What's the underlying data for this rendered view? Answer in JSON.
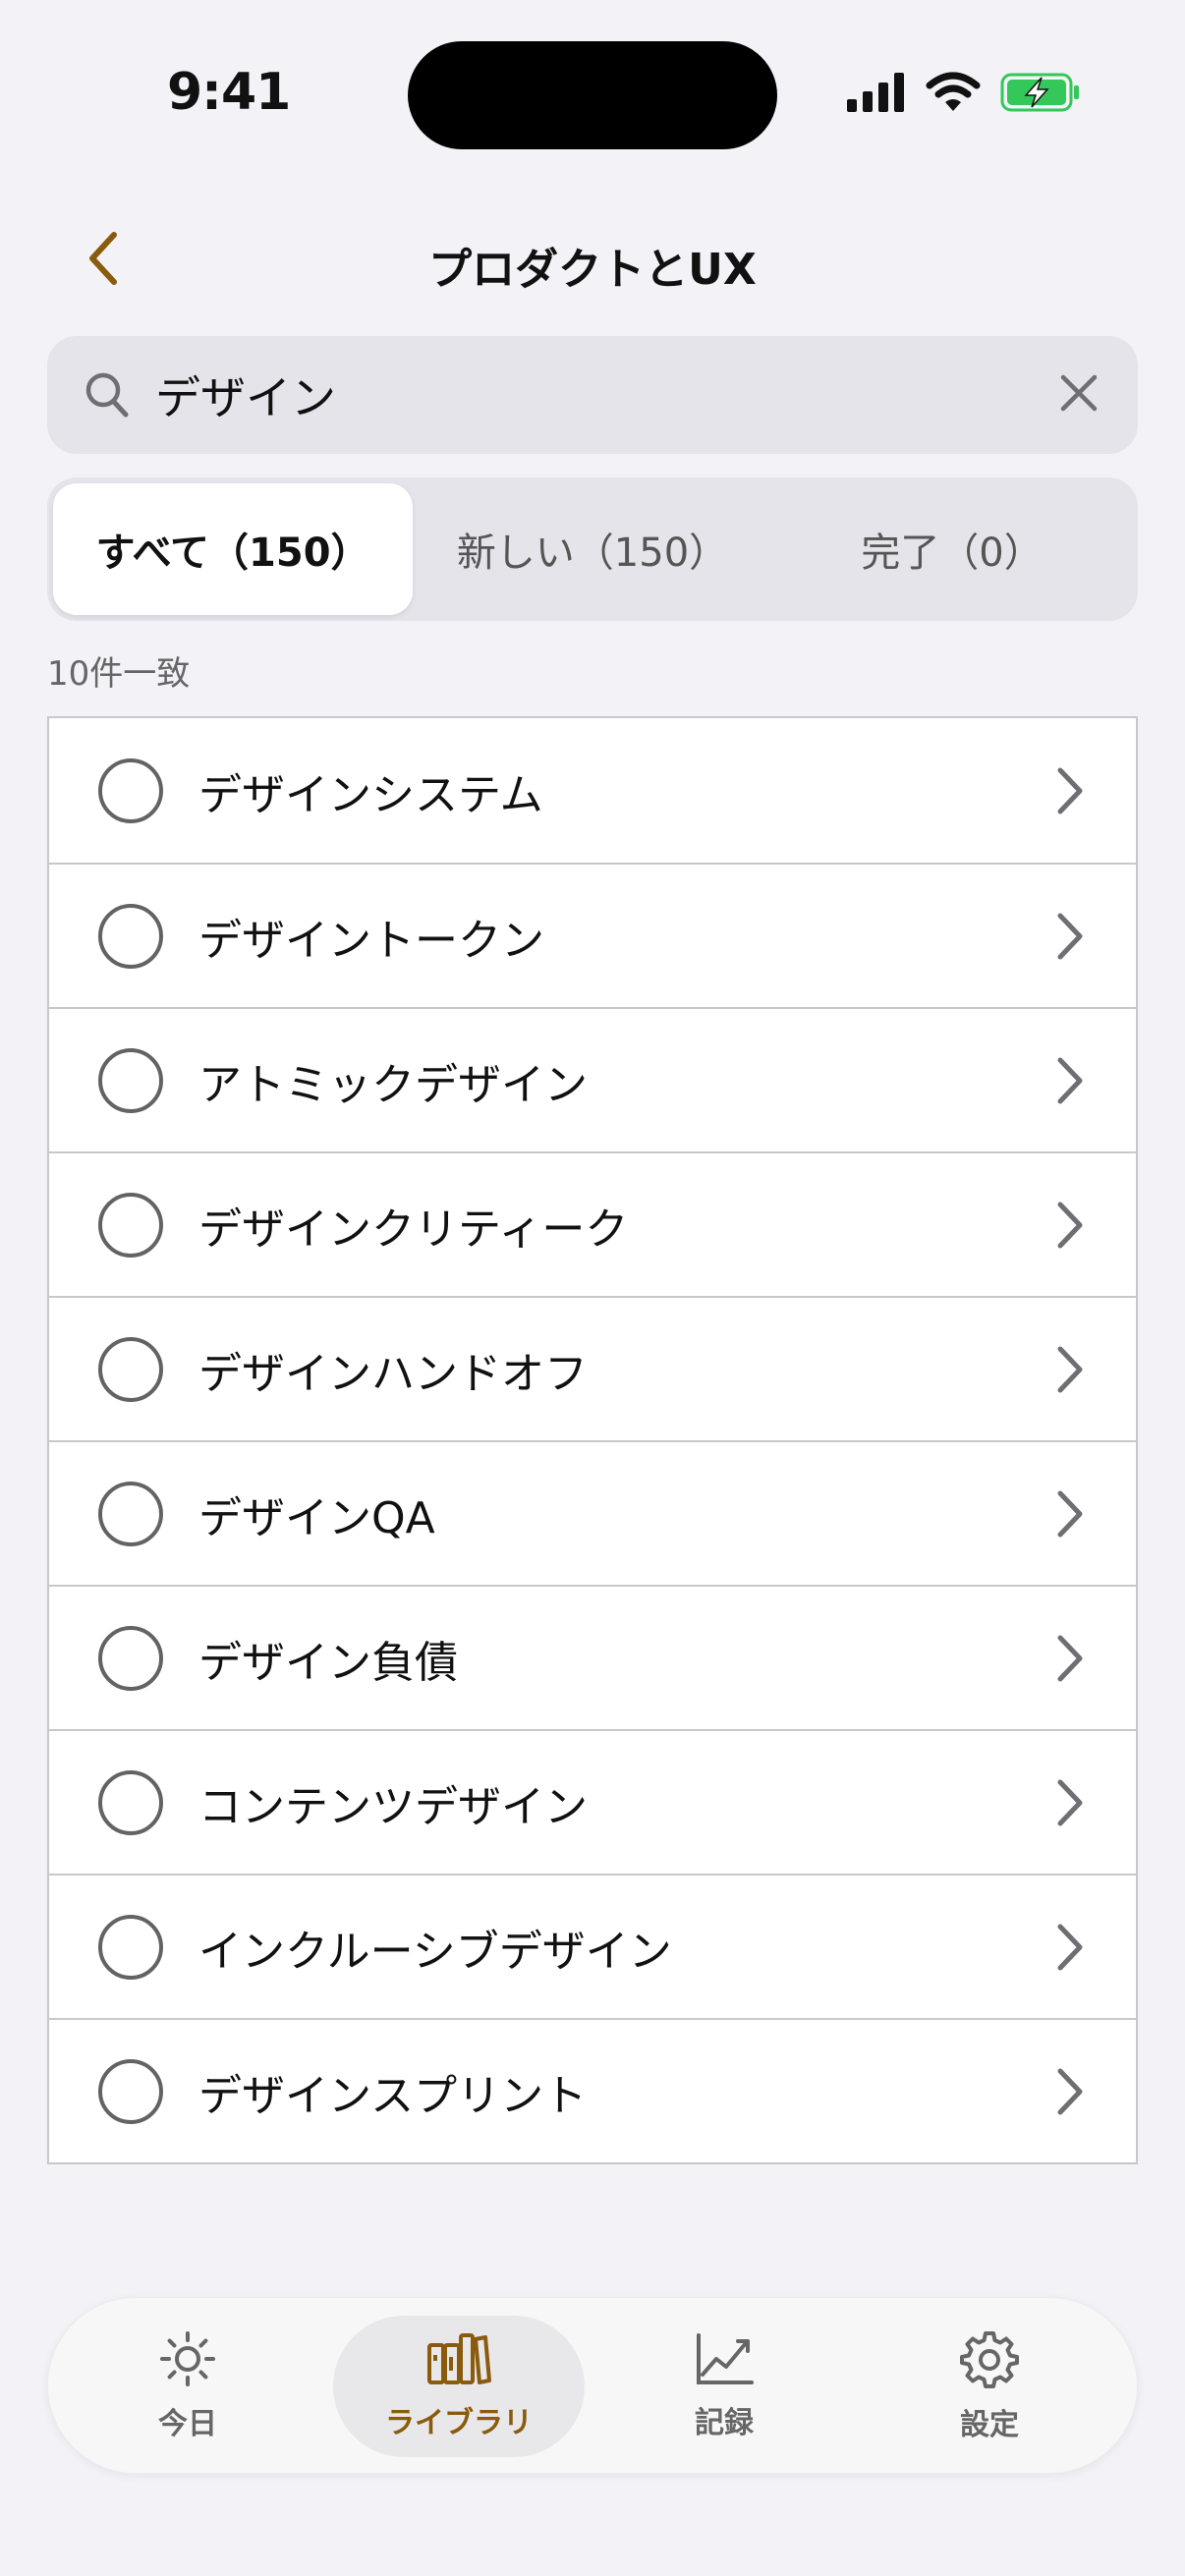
{
  "status_bar": {
    "time": "9:41",
    "signal_icon": "cellular-signal-icon",
    "wifi_icon": "wifi-icon",
    "battery_icon": "battery-charging-icon",
    "battery_color": "#34c759"
  },
  "nav": {
    "title": "プロダクトとUX",
    "back_icon": "chevron-left-icon",
    "accent_color": "#8a5a0d"
  },
  "search": {
    "value": "デザイン",
    "placeholder": "",
    "search_icon": "magnifying-glass-icon",
    "clear_icon": "close-icon"
  },
  "segments": [
    {
      "label": "すべて（150）",
      "active": true
    },
    {
      "label": "新しい（150）",
      "active": false
    },
    {
      "label": "完了（0）",
      "active": false
    }
  ],
  "match_count": "10件一致",
  "results": [
    {
      "label": "デザインシステム"
    },
    {
      "label": "デザイントークン"
    },
    {
      "label": "アトミックデザイン"
    },
    {
      "label": "デザインクリティーク"
    },
    {
      "label": "デザインハンドオフ"
    },
    {
      "label": "デザインQA"
    },
    {
      "label": "デザイン負債"
    },
    {
      "label": "コンテンツデザイン"
    },
    {
      "label": "インクルーシブデザイン"
    },
    {
      "label": "デザインスプリント"
    }
  ],
  "tab_bar": {
    "tabs": [
      {
        "label": "今日",
        "icon": "sun-icon",
        "active": false
      },
      {
        "label": "ライブラリ",
        "icon": "books-icon",
        "active": true
      },
      {
        "label": "記録",
        "icon": "chart-line-icon",
        "active": false
      },
      {
        "label": "設定",
        "icon": "gear-icon",
        "active": false
      }
    ]
  }
}
